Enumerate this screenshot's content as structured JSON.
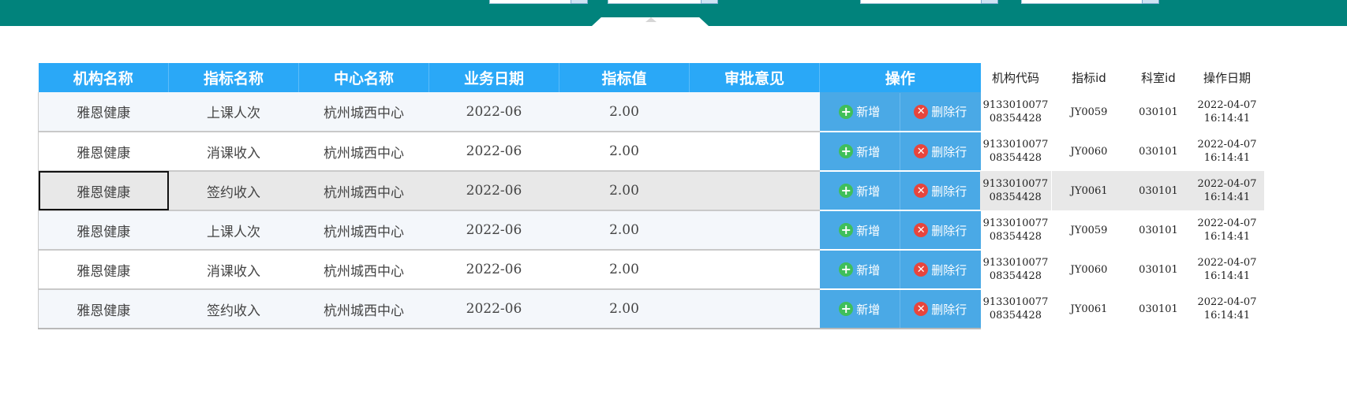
{
  "grid": {
    "headers": [
      "机构名称",
      "指标名称",
      "中心名称",
      "业务日期",
      "指标值",
      "审批意见",
      "操作"
    ],
    "add_label": "新增",
    "delete_label": "删除行",
    "rows": [
      {
        "org": "雅恩健康",
        "metric": "上课人次",
        "center": "杭州城西中心",
        "date": "2022-06",
        "value": "2.00",
        "opinion": ""
      },
      {
        "org": "雅恩健康",
        "metric": "消课收入",
        "center": "杭州城西中心",
        "date": "2022-06",
        "value": "2.00",
        "opinion": ""
      },
      {
        "org": "雅恩健康",
        "metric": "签约收入",
        "center": "杭州城西中心",
        "date": "2022-06",
        "value": "2.00",
        "opinion": ""
      },
      {
        "org": "雅恩健康",
        "metric": "上课人次",
        "center": "杭州城西中心",
        "date": "2022-06",
        "value": "2.00",
        "opinion": ""
      },
      {
        "org": "雅恩健康",
        "metric": "消课收入",
        "center": "杭州城西中心",
        "date": "2022-06",
        "value": "2.00",
        "opinion": ""
      },
      {
        "org": "雅恩健康",
        "metric": "签约收入",
        "center": "杭州城西中心",
        "date": "2022-06",
        "value": "2.00",
        "opinion": ""
      }
    ]
  },
  "side": {
    "headers": [
      "机构代码",
      "指标id",
      "科室id",
      "操作日期"
    ],
    "rows": [
      {
        "code1": "9133010077",
        "code2": "08354428",
        "metric_id": "JY0059",
        "dept_id": "030101",
        "op_date": "2022-04-07",
        "op_time": "16:14:41"
      },
      {
        "code1": "9133010077",
        "code2": "08354428",
        "metric_id": "JY0060",
        "dept_id": "030101",
        "op_date": "2022-04-07",
        "op_time": "16:14:41"
      },
      {
        "code1": "9133010077",
        "code2": "08354428",
        "metric_id": "JY0061",
        "dept_id": "030101",
        "op_date": "2022-04-07",
        "op_time": "16:14:41"
      },
      {
        "code1": "9133010077",
        "code2": "08354428",
        "metric_id": "JY0059",
        "dept_id": "030101",
        "op_date": "2022-04-07",
        "op_time": "16:14:41"
      },
      {
        "code1": "9133010077",
        "code2": "08354428",
        "metric_id": "JY0060",
        "dept_id": "030101",
        "op_date": "2022-04-07",
        "op_time": "16:14:41"
      },
      {
        "code1": "9133010077",
        "code2": "08354428",
        "metric_id": "JY0061",
        "dept_id": "030101",
        "op_date": "2022-04-07",
        "op_time": "16:14:41"
      }
    ]
  }
}
